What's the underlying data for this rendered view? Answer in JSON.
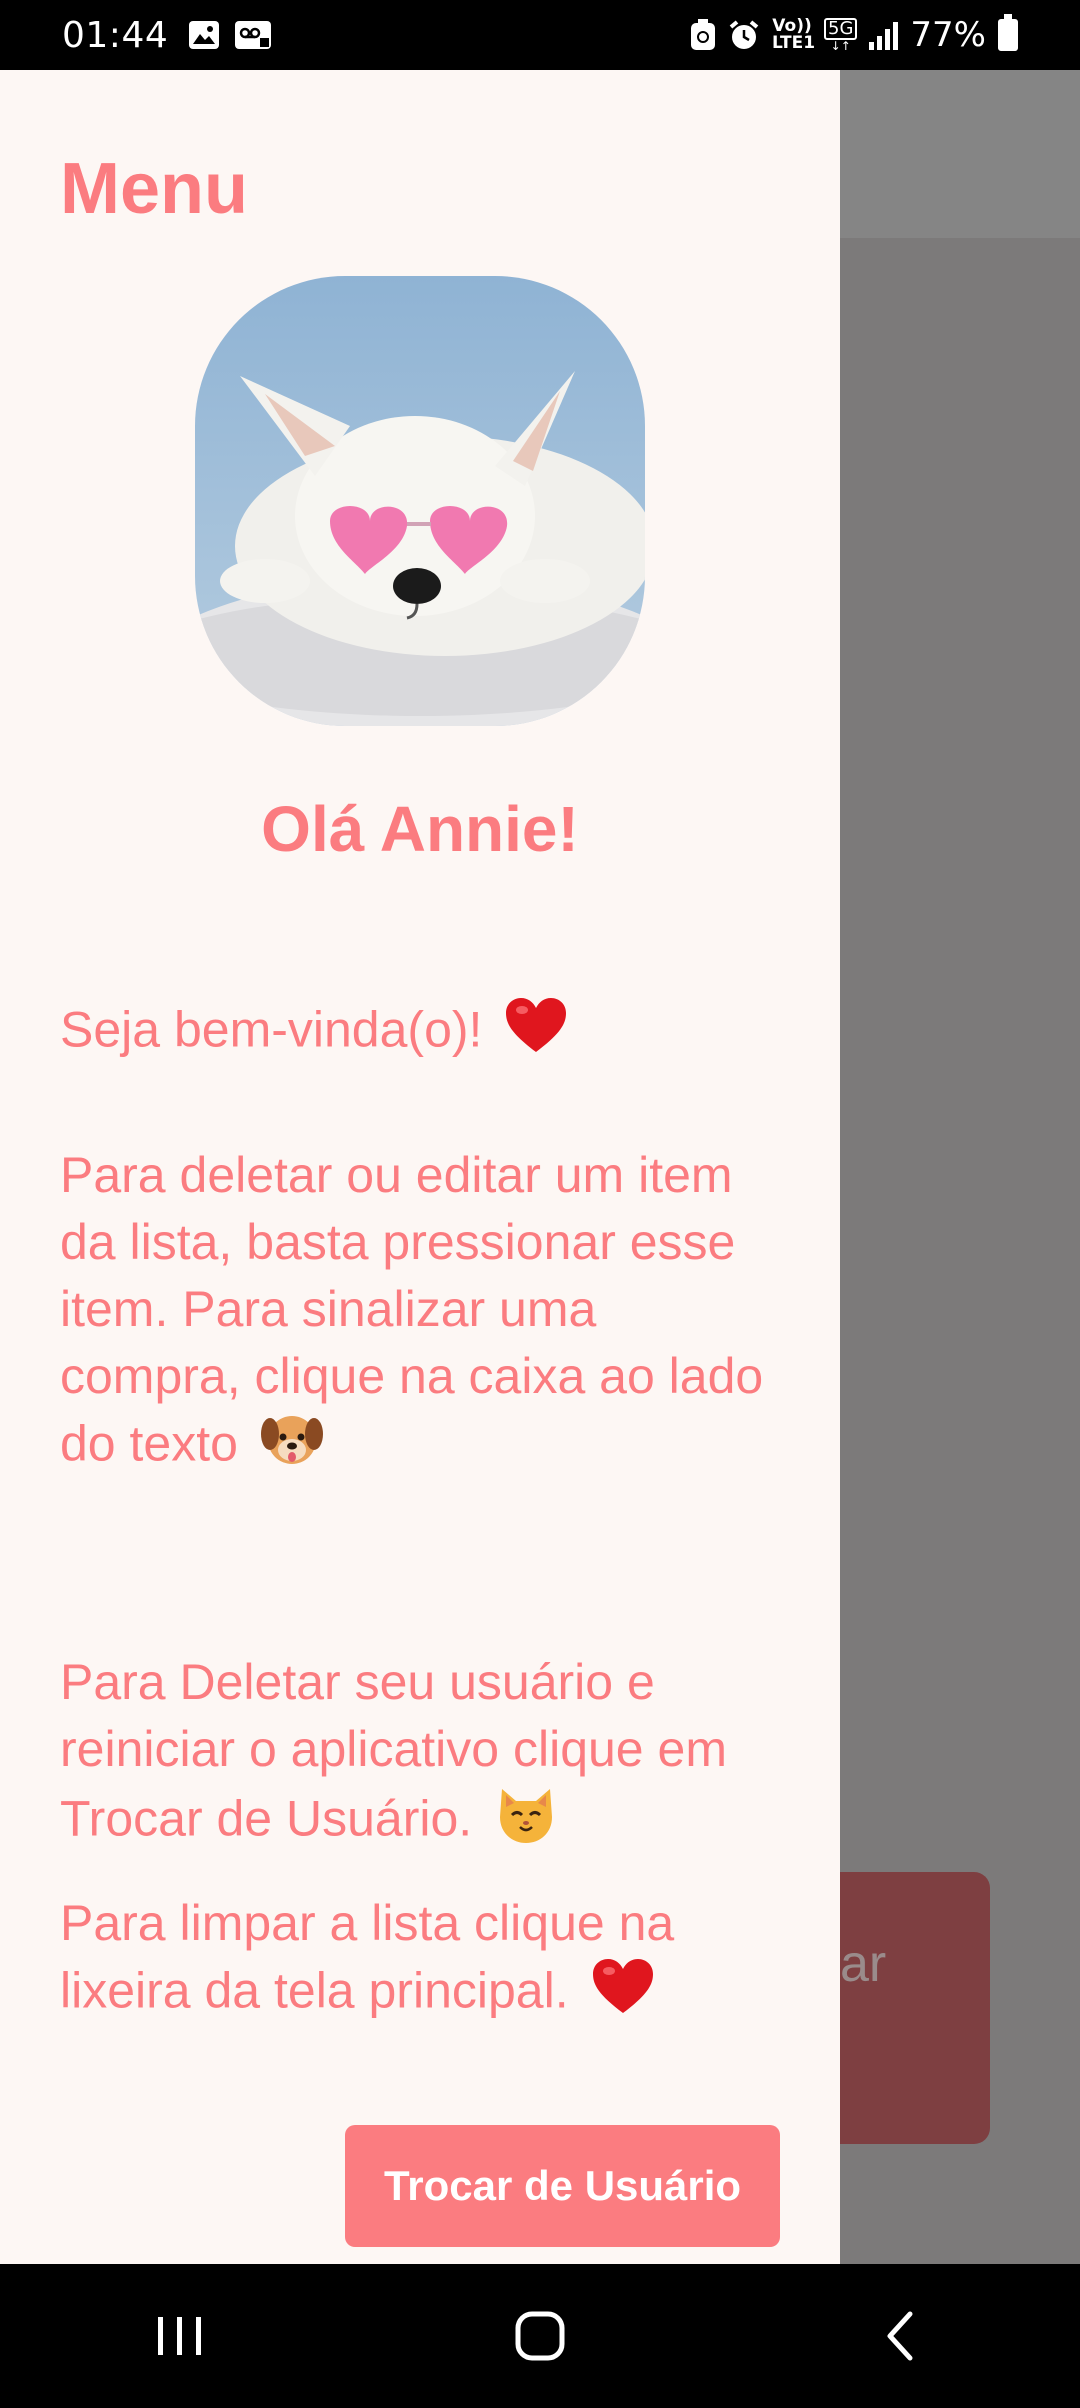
{
  "status_bar": {
    "time": "01:44",
    "battery": "77%",
    "network_label": "5G",
    "volte_label": "Vo)) LTE1"
  },
  "drawer": {
    "title": "Menu",
    "greeting": "Olá Annie!",
    "welcome": "Seja bem-vinda(o)!",
    "instructions": [
      "Para deletar ou editar um item da lista, basta pressionar esse item. Para sinalizar uma compra, clique na caixa ao lado do texto",
      "Para Deletar seu usuário e reiniciar o aplicativo clique em Trocar de Usuário.",
      "Para limpar a lista clique na lixeira da tela principal."
    ],
    "switch_user_label": "Trocar de Usuário"
  },
  "background_app": {
    "partial_button_text": "ar"
  },
  "colors": {
    "accent": "#fb7c80",
    "drawer_bg": "#fdf7f4",
    "scrim": "#7c7a7a"
  },
  "icons": [
    "heart-emoji",
    "dog-emoji",
    "cat-emoji",
    "recents-icon",
    "home-icon",
    "back-icon"
  ]
}
